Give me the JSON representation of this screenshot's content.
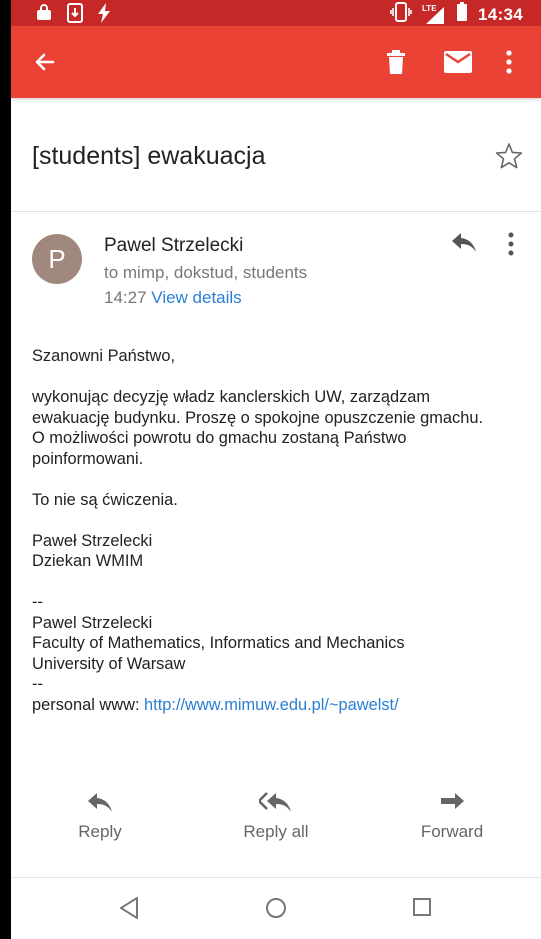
{
  "status_bar": {
    "time": "14:34",
    "network_label": "LTE",
    "icons": [
      "bag-icon",
      "download-icon",
      "flash-icon",
      "vibrate-icon",
      "signal-icon",
      "battery-icon"
    ]
  },
  "app_bar": {
    "background_color": "#ea4335",
    "icons": [
      "back-arrow-icon",
      "trash-icon",
      "mail-icon",
      "more-vert-icon"
    ]
  },
  "email": {
    "subject": "[students] ewakuacja",
    "sender": {
      "initial": "P",
      "name": "Pawel Strzelecki",
      "to": "to mimp, dokstud, students",
      "time": "14:27",
      "view_details": "View details"
    },
    "body": {
      "greeting": "Szanowni Państwo,",
      "para1_line1": "wykonując decyzję władz kanclerskich UW, zarządzam",
      "para1_line2": "ewakuację budynku. Proszę o spokojne opuszczenie gmachu.",
      "para1_line3": "O możliwości powrotu do gmachu zostaną Państwo",
      "para1_line4": "poinformowani.",
      "para2": "To nie są ćwiczenia.",
      "sig1_line1": "Paweł Strzelecki",
      "sig1_line2": "Dziekan WMIM",
      "sep1": "--",
      "sig2_line1": "Pawel Strzelecki",
      "sig2_line2": "Faculty of Mathematics, Informatics and Mechanics",
      "sig2_line3": "University of Warsaw",
      "sep2": "--",
      "www_label": "personal www: ",
      "www_link": "http://www.mimuw.edu.pl/~pawelst/"
    }
  },
  "actions": {
    "reply": "Reply",
    "reply_all": "Reply all",
    "forward": "Forward"
  },
  "colors": {
    "accent": "#ea4335",
    "status_bar": "#c62828",
    "link": "#2a7fd4",
    "avatar": "#a1887f"
  }
}
